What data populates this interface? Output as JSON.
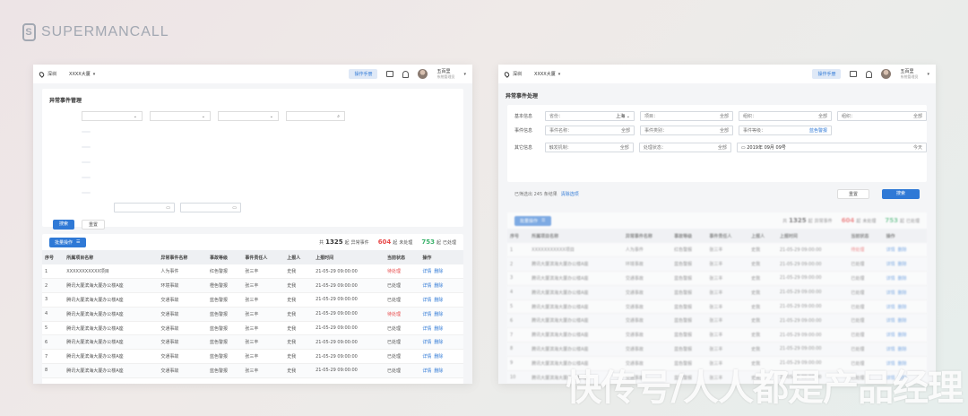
{
  "brand": "SUPERMANCALL",
  "topbar": {
    "city": "深圳",
    "building": "XXXX大厦",
    "manual": "操作手册",
    "user": "五百里",
    "role": "系统管理员"
  },
  "left": {
    "title": "异常事件管理",
    "rows": [
      [
        "1",
        "XXXXXXXXXXX项目",
        "人为事件",
        "红色警报",
        "张三丰",
        "史我",
        "21-05-29 09:00:00",
        "待处理"
      ],
      [
        "2",
        "腾讯大厦滨海大厦办公楼A座",
        "环境事故",
        "橙色警报",
        "张三丰",
        "史我",
        "21-05-29 09:00:00",
        "已处理"
      ],
      [
        "3",
        "腾讯大厦滨海大厦办公楼A座",
        "交通事故",
        "蓝色警报",
        "张三丰",
        "史我",
        "21-05-29 09:00:00",
        "已处理"
      ],
      [
        "4",
        "腾讯大厦滨海大厦办公楼A座",
        "交通事故",
        "蓝色警报",
        "张三丰",
        "史我",
        "21-05-29 09:00:00",
        "待处理"
      ],
      [
        "5",
        "腾讯大厦滨海大厦办公楼A座",
        "交通事故",
        "蓝色警报",
        "张三丰",
        "史我",
        "21-05-29 09:00:00",
        "已处理"
      ],
      [
        "6",
        "腾讯大厦滨海大厦办公楼A座",
        "交通事故",
        "蓝色警报",
        "张三丰",
        "史我",
        "21-05-29 09:00:00",
        "已处理"
      ],
      [
        "7",
        "腾讯大厦滨海大厦办公楼A座",
        "交通事故",
        "蓝色警报",
        "张三丰",
        "史我",
        "21-05-29 09:00:00",
        "已处理"
      ],
      [
        "8",
        "腾讯大厦滨海大厦办公楼A座",
        "交通事故",
        "蓝色警报",
        "张三丰",
        "史我",
        "21-05-29 09:00:00",
        "已处理"
      ]
    ],
    "search": "搜索",
    "reset": "重置",
    "batch": "批量操作",
    "stats": {
      "pre": "共",
      "total": "1325",
      "unit1": "起",
      "l1": "异常事件",
      "pending": "604",
      "unit2": "起",
      "l2": "未处理",
      "done": "753",
      "unit3": "起",
      "l3": "已处理"
    },
    "columns": [
      "序号",
      "所属项目名称",
      "异常事件名称",
      "事故等级",
      "事件责任人",
      "上报人",
      "上报时间",
      "当前状态",
      "操作"
    ],
    "actions": [
      "详情",
      "删除"
    ]
  },
  "right": {
    "title": "异常事件处理",
    "row1": {
      "label": "基本信息",
      "province": "省份：",
      "province_val": "上海",
      "project": "项目：",
      "project_val": "全部",
      "org": "组织：",
      "org_val": "全部",
      "group": "组织：",
      "group_val": "全部"
    },
    "row2": {
      "label": "事件信息",
      "name": "事件名称：",
      "name_val": "全部",
      "cat": "事件类别：",
      "cat_val": "全部",
      "level": "事件等级：",
      "level_val": "蓝色警报"
    },
    "row3": {
      "label": "其它信息",
      "trigger": "触发机制：",
      "trigger_val": "全部",
      "status": "处理状态：",
      "status_val": "全部",
      "date": "2019年 09月 09号",
      "date_hint": "今天"
    },
    "selected": "已筛选出 245 条结果",
    "clear": "清除选项",
    "reset": "重置",
    "search": "搜索",
    "batch": "批量操作",
    "stats": {
      "pre": "共",
      "total": "1325",
      "unit1": "起",
      "l1": "异常事件",
      "pending": "604",
      "unit2": "起",
      "l2": "未处理",
      "done": "753",
      "unit3": "起",
      "l3": "已处理"
    },
    "columns": [
      "序号",
      "所属项目名称",
      "异常事件名称",
      "事故等级",
      "事件责任人",
      "上报人",
      "上报时间",
      "当前状态",
      "操作"
    ],
    "rows": [
      [
        "1",
        "XXXXXXXXXXX项目",
        "人为事件",
        "红色警报",
        "张三丰",
        "史我",
        "21-05-29 09:00:00",
        "待处理"
      ],
      [
        "2",
        "腾讯大厦滨海大厦办公楼A座",
        "环境事故",
        "蓝色警报",
        "张三丰",
        "史我",
        "21-05-29 09:00:00",
        "已处理"
      ],
      [
        "3",
        "腾讯大厦滨海大厦办公楼A座",
        "交通事故",
        "蓝色警报",
        "张三丰",
        "史我",
        "21-05-29 09:00:00",
        "已处理"
      ],
      [
        "4",
        "腾讯大厦滨海大厦办公楼A座",
        "交通事故",
        "蓝色警报",
        "张三丰",
        "史我",
        "21-05-29 09:00:00",
        "已处理"
      ],
      [
        "5",
        "腾讯大厦滨海大厦办公楼A座",
        "交通事故",
        "蓝色警报",
        "张三丰",
        "史我",
        "21-05-29 09:00:00",
        "已处理"
      ],
      [
        "6",
        "腾讯大厦滨海大厦办公楼A座",
        "交通事故",
        "蓝色警报",
        "张三丰",
        "史我",
        "21-05-29 09:00:00",
        "已处理"
      ],
      [
        "7",
        "腾讯大厦滨海大厦办公楼A座",
        "交通事故",
        "蓝色警报",
        "张三丰",
        "史我",
        "21-05-29 09:00:00",
        "已处理"
      ],
      [
        "8",
        "腾讯大厦滨海大厦办公楼A座",
        "交通事故",
        "蓝色警报",
        "张三丰",
        "史我",
        "21-05-29 09:00:00",
        "已处理"
      ],
      [
        "9",
        "腾讯大厦滨海大厦办公楼A座",
        "交通事故",
        "蓝色警报",
        "张三丰",
        "史我",
        "21-05-29 09:00:00",
        "已处理"
      ],
      [
        "10",
        "腾讯大厦滨海大厦办公楼A座",
        "交通事故",
        "蓝色警报",
        "张三丰",
        "史我",
        "21-05-29 09:00:00",
        "已处理"
      ],
      [
        "11",
        "腾讯大厦滨海大厦办公楼A座",
        "交通事故",
        "蓝色警报",
        "张三丰",
        "史我",
        "21-05-29 09:00:00",
        "已处理"
      ]
    ],
    "actions": [
      "详情",
      "删除"
    ]
  },
  "watermark": "快传号/人人都是产品经理"
}
